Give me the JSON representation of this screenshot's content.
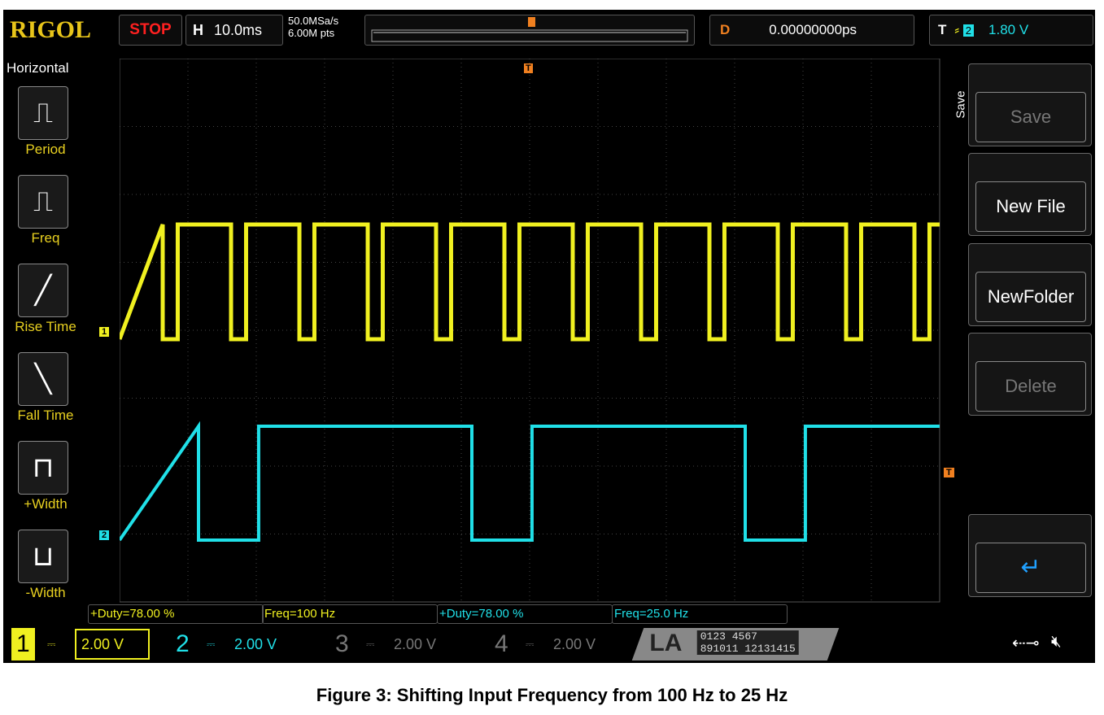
{
  "header": {
    "brand": "RIGOL",
    "run_state": "STOP",
    "horizontal_label": "H",
    "timebase": "10.0ms",
    "sample_rate": "50.0MSa/s",
    "memory_depth": "6.00M pts",
    "delay_label": "D",
    "delay": "0.00000000ps",
    "trigger_label": "T",
    "trigger_source": "2",
    "trigger_level": "1.80 V"
  },
  "left_menu": {
    "title": "Horizontal",
    "items": [
      {
        "label": "Period"
      },
      {
        "label": "Freq"
      },
      {
        "label": "Rise Time"
      },
      {
        "label": "Fall Time"
      },
      {
        "label": "+Width"
      },
      {
        "label": "-Width"
      }
    ]
  },
  "right_menu": {
    "title": "Save",
    "items": [
      {
        "label": "Save",
        "enabled": false
      },
      {
        "label": "New File",
        "enabled": true
      },
      {
        "label": "NewFolder",
        "enabled": true
      },
      {
        "label": "Delete",
        "enabled": false
      },
      {
        "label": "",
        "icon": "enter-icon"
      }
    ]
  },
  "measurements": [
    {
      "text": "+Duty=78.00 %",
      "color": "#f0f020"
    },
    {
      "text": "Freq=100 Hz",
      "color": "#f0f020"
    },
    {
      "text": "+Duty=78.00 %",
      "color": "#20e0e8"
    },
    {
      "text": "Freq=25.0 Hz",
      "color": "#20e0e8"
    }
  ],
  "channels": [
    {
      "num": "1",
      "scale": "2.00 V",
      "color": "#f0f020"
    },
    {
      "num": "2",
      "scale": "2.00 V",
      "color": "#20e0e8"
    },
    {
      "num": "3",
      "scale": "2.00 V",
      "color": "#777"
    },
    {
      "num": "4",
      "scale": "2.00 V",
      "color": "#777"
    }
  ],
  "la": {
    "label": "LA",
    "bits_top": "0123 4567",
    "bits_bottom": "891011 12131415"
  },
  "markers": {
    "ch1": "1",
    "ch2": "2",
    "trigger": "T"
  },
  "waveforms": [
    {
      "channel": "1",
      "frequency_hz": 100,
      "duty": 0.78,
      "color": "#f0f020"
    },
    {
      "channel": "2",
      "frequency_hz": 25,
      "duty": 0.78,
      "color": "#20e0e8"
    }
  ],
  "caption": "Figure 3: Shifting Input Frequency from 100 Hz to 25 Hz"
}
